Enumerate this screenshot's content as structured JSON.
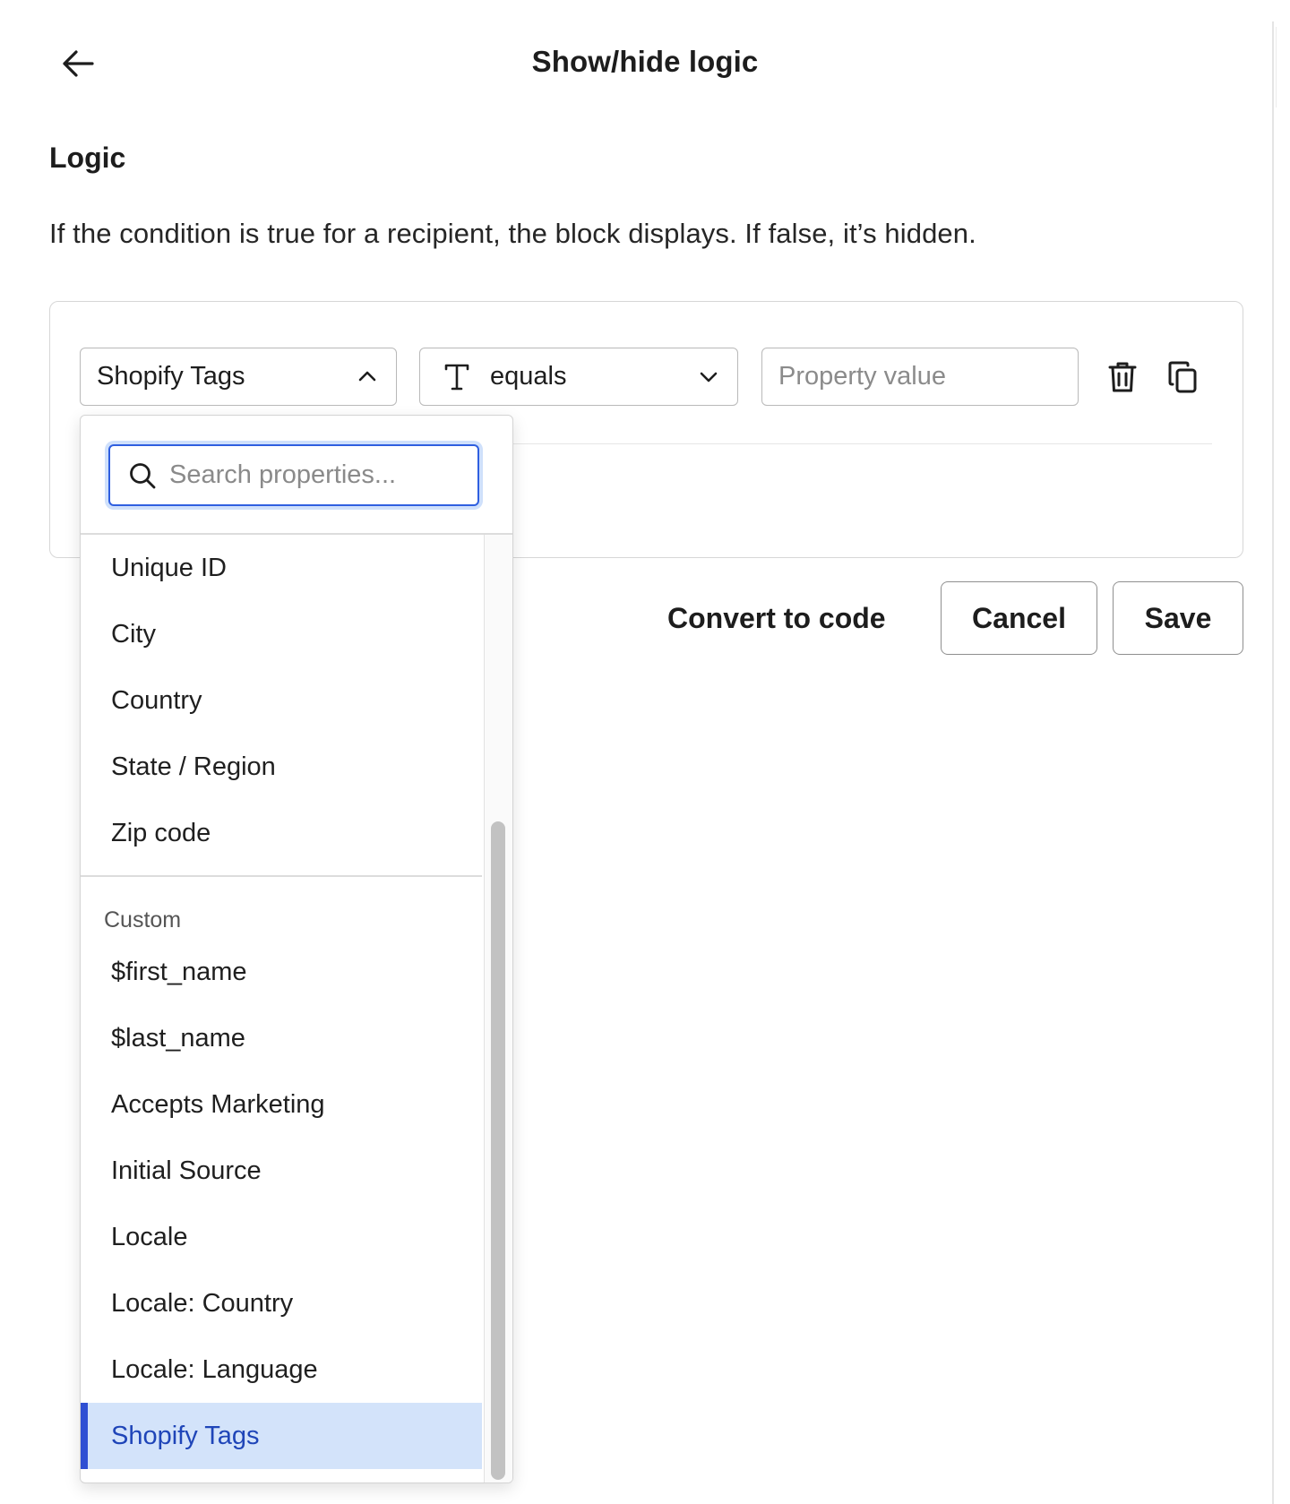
{
  "header": {
    "title": "Show/hide logic",
    "back_icon": "arrow-left-icon"
  },
  "logic": {
    "heading": "Logic",
    "description": "If the condition is true for a recipient, the block displays. If false, it’s hidden."
  },
  "condition": {
    "property": "Shopify Tags",
    "operator_type_icon": "text-type-icon",
    "operator": "equals",
    "value": "",
    "value_placeholder": "Property value",
    "delete_icon": "trash-icon",
    "duplicate_icon": "copy-icon"
  },
  "actions": {
    "convert_label": "Convert to code",
    "cancel_label": "Cancel",
    "save_label": "Save"
  },
  "dropdown": {
    "search_value": "",
    "search_placeholder": "Search properties...",
    "items_top": [
      "Unique ID",
      "City",
      "Country",
      "State / Region",
      "Zip code"
    ],
    "custom_label": "Custom",
    "items_custom": [
      "$first_name",
      "$last_name",
      "Accepts Marketing",
      "Initial Source",
      "Locale",
      "Locale: Country",
      "Locale: Language",
      "Shopify Tags"
    ],
    "selected": "Shopify Tags"
  },
  "colors": {
    "accent": "#2f4fd3",
    "selected_bg": "#d3e3fa",
    "focus_ring": "#cfe0fb"
  }
}
